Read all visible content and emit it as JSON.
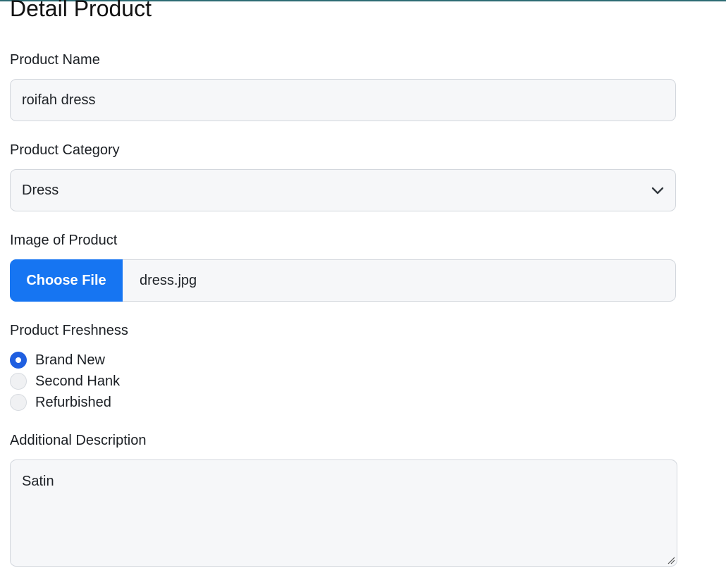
{
  "page": {
    "title": "Detail Product"
  },
  "product_name": {
    "label": "Product Name",
    "value": "roifah dress"
  },
  "product_category": {
    "label": "Product Category",
    "selected": "Dress"
  },
  "product_image": {
    "label": "Image of Product",
    "button_label": "Choose File",
    "file_name": "dress.jpg"
  },
  "product_freshness": {
    "label": "Product Freshness",
    "options": [
      {
        "label": "Brand New",
        "checked": true
      },
      {
        "label": "Second Hank",
        "checked": false
      },
      {
        "label": "Refurbished",
        "checked": false
      }
    ]
  },
  "additional_description": {
    "label": "Additional Description",
    "value": "Satin"
  },
  "colors": {
    "accent": "#1675f2",
    "radio_checked": "#1f5fe0",
    "field_background": "#f6f7f9",
    "top_border": "#2c6b73"
  },
  "icons": {
    "select": "chevron-down-icon",
    "textarea": "resize-handle-icon"
  }
}
